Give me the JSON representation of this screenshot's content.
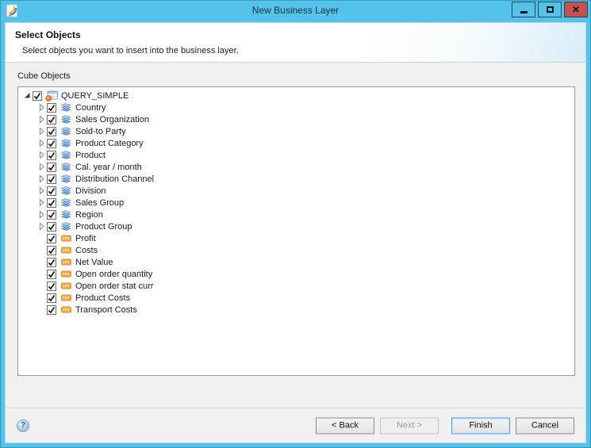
{
  "window": {
    "title": "New Business Layer",
    "controls": [
      {
        "name": "minimize-button",
        "icon": "minimize-icon"
      },
      {
        "name": "maximize-button",
        "icon": "maximize-icon"
      },
      {
        "name": "close-button",
        "icon": "close-icon",
        "glyph": "✕"
      }
    ]
  },
  "header": {
    "title": "Select Objects",
    "subtitle": "Select objects you want to insert into the business layer."
  },
  "content": {
    "group_label": "Cube Objects"
  },
  "tree": {
    "items": [
      {
        "label": "QUERY_SIMPLE",
        "icon": "query-icon",
        "level": 0,
        "expander": "expanded",
        "checked": true
      },
      {
        "label": "Country",
        "icon": "dimension-icon",
        "level": 1,
        "expander": "collapsed",
        "checked": true
      },
      {
        "label": "Sales Organization",
        "icon": "dimension-icon",
        "level": 1,
        "expander": "collapsed",
        "checked": true
      },
      {
        "label": "Sold-to Party",
        "icon": "dimension-icon",
        "level": 1,
        "expander": "collapsed",
        "checked": true
      },
      {
        "label": "Product Category",
        "icon": "dimension-icon",
        "level": 1,
        "expander": "collapsed",
        "checked": true
      },
      {
        "label": "Product",
        "icon": "dimension-icon",
        "level": 1,
        "expander": "collapsed",
        "checked": true
      },
      {
        "label": "Cal. year / month",
        "icon": "dimension-icon",
        "level": 1,
        "expander": "collapsed",
        "checked": true
      },
      {
        "label": "Distribution Channel",
        "icon": "dimension-icon",
        "level": 1,
        "expander": "collapsed",
        "checked": true
      },
      {
        "label": "Division",
        "icon": "dimension-icon",
        "level": 1,
        "expander": "collapsed",
        "checked": true
      },
      {
        "label": "Sales Group",
        "icon": "dimension-icon",
        "level": 1,
        "expander": "collapsed",
        "checked": true
      },
      {
        "label": "Region",
        "icon": "dimension-icon",
        "level": 1,
        "expander": "collapsed",
        "checked": true
      },
      {
        "label": "Product Group",
        "icon": "dimension-icon",
        "level": 1,
        "expander": "collapsed",
        "checked": true
      },
      {
        "label": "Profit",
        "icon": "measure-icon",
        "level": 1,
        "expander": "none",
        "checked": true
      },
      {
        "label": "Costs",
        "icon": "measure-icon",
        "level": 1,
        "expander": "none",
        "checked": true
      },
      {
        "label": "Net Value",
        "icon": "measure-icon",
        "level": 1,
        "expander": "none",
        "checked": true
      },
      {
        "label": "Open order quantity",
        "icon": "measure-icon",
        "level": 1,
        "expander": "none",
        "checked": true
      },
      {
        "label": "Open order stat curr",
        "icon": "measure-icon",
        "level": 1,
        "expander": "none",
        "checked": true
      },
      {
        "label": "Product Costs",
        "icon": "measure-icon",
        "level": 1,
        "expander": "none",
        "checked": true
      },
      {
        "label": "Transport Costs",
        "icon": "measure-icon",
        "level": 1,
        "expander": "none",
        "checked": true
      }
    ]
  },
  "footer": {
    "help_icon": "?",
    "buttons": [
      {
        "name": "back-button",
        "label": "< Back",
        "enabled": true,
        "focused": false
      },
      {
        "name": "next-button",
        "label": "Next >",
        "enabled": false,
        "focused": false
      },
      {
        "name": "finish-button",
        "label": "Finish",
        "enabled": true,
        "focused": true
      },
      {
        "name": "cancel-button",
        "label": "Cancel",
        "enabled": true,
        "focused": false
      }
    ]
  },
  "colors": {
    "frame_blue": "#55c3e9",
    "close_red": "#c75050",
    "focus_blue": "#569de5",
    "measure_orange": "#f0a238",
    "dimension_blue": "#7fa9dc"
  }
}
